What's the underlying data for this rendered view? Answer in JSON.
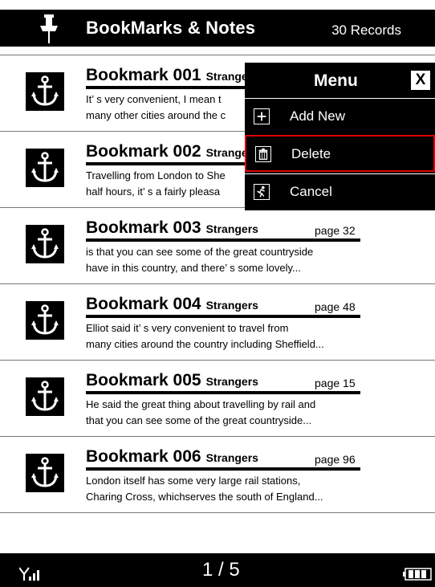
{
  "header": {
    "title": "BookMarks & Notes",
    "records": "30 Records",
    "pin_icon": "pushpin-icon"
  },
  "bookmarks": [
    {
      "title": "Bookmark 001",
      "book": "Strangers",
      "page": "",
      "line1": "It’ s very convenient, I mean t",
      "line2": "many other cities around the c"
    },
    {
      "title": "Bookmark 002",
      "book": "Strangers",
      "page": "",
      "line1": "Travelling from London to She",
      "line2": "half hours, it’ s a fairly pleasa"
    },
    {
      "title": "Bookmark 003",
      "book": "Strangers",
      "page": "page 32",
      "line1": "is that you can see some of the great countryside",
      "line2": "have in this country, and there’ s some lovely..."
    },
    {
      "title": "Bookmark 004",
      "book": "Strangers",
      "page": "page 48",
      "line1": "Elliot said it’ s very convenient to travel from",
      "line2": "many cities around the country including Sheffield..."
    },
    {
      "title": "Bookmark 005",
      "book": "Strangers",
      "page": "page 15",
      "line1": "He said the great thing about travelling by rail and",
      "line2": "that you can see some of the great countryside..."
    },
    {
      "title": "Bookmark 006",
      "book": "Strangers",
      "page": "page 96",
      "line1": "London itself has some very large rail stations,",
      "line2": "Charing Cross, whichserves the south of England..."
    }
  ],
  "menu": {
    "title": "Menu",
    "close_label": "X",
    "items": [
      {
        "label": "Add New",
        "icon": "plus-icon"
      },
      {
        "label": "Delete",
        "icon": "trash-icon",
        "selected": true
      },
      {
        "label": "Cancel",
        "icon": "cancel-icon"
      }
    ]
  },
  "footer": {
    "pager": "1 / 5",
    "signal_icon": "signal-icon",
    "battery_icon": "battery-icon"
  },
  "colors": {
    "bar": "#000000",
    "selection": "#e00000"
  }
}
